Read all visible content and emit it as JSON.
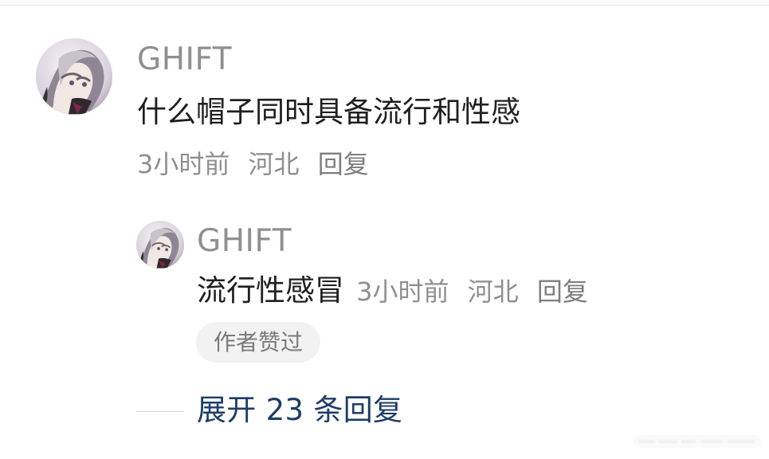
{
  "comment": {
    "username": "GHIFT",
    "text": "什么帽子同时具备流行和性感",
    "time": "3小时前",
    "location": "河北",
    "reply_label": "回复"
  },
  "reply": {
    "username": "GHIFT",
    "text": "流行性感冒",
    "time": "3小时前",
    "location": "河北",
    "reply_label": "回复",
    "author_liked_label": "作者赞过"
  },
  "expand": {
    "label": "展开 23 条回复"
  },
  "icons": {
    "avatar": "anime-avatar-icon",
    "watermark": "watermark-icon"
  },
  "colors": {
    "username": "#8f8f8f",
    "text": "#1f1f1f",
    "link": "#1d3d67",
    "badge": "#f2f2f2"
  }
}
